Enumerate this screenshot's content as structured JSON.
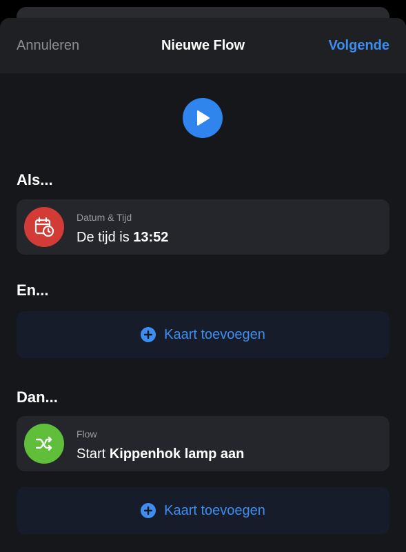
{
  "nav": {
    "cancel_label": "Annuleren",
    "title": "Nieuwe Flow",
    "next_label": "Volgende"
  },
  "sections": {
    "if_title": "Als...",
    "and_title": "En...",
    "then_title": "Dan..."
  },
  "if_card": {
    "category": "Datum & Tijd",
    "text_prefix": "De tijd is",
    "text_value": "13:52",
    "icon": "calendar-clock-icon",
    "icon_color": "#d33b36"
  },
  "then_card": {
    "category": "Flow",
    "text_prefix": "Start",
    "text_value": "Kippenhok lamp aan",
    "icon": "shuffle-icon",
    "icon_color": "#5fbf3a"
  },
  "add_card_label": "Kaart toevoegen",
  "colors": {
    "accent": "#3d8ef0",
    "background": "#16171b",
    "card": "#25262b"
  }
}
